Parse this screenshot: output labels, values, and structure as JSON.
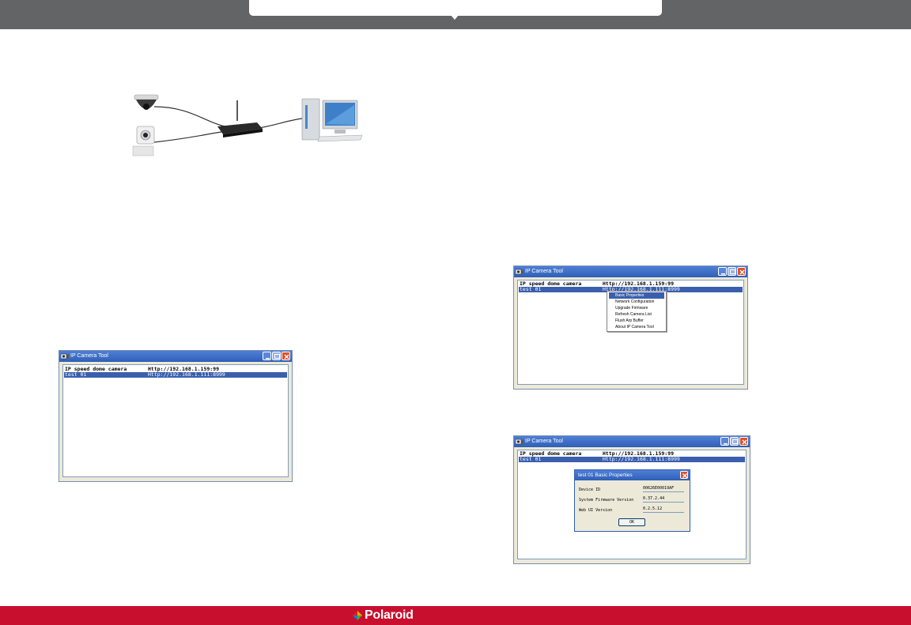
{
  "brand": {
    "name": "Polaroid"
  },
  "colors": {
    "top_bar": "#636466",
    "bottom_bar": "#c8102e",
    "selection": "#3a5fad",
    "titlebar": "#2f5fb6"
  },
  "window": {
    "title": "IP Camera Tool",
    "cameras": [
      {
        "name": "IP speed dome camera",
        "url": "Http://192.168.1.159:99"
      },
      {
        "name": "test 01",
        "url": "Http://192.168.1.111:8999"
      }
    ]
  },
  "context_menu": {
    "items": [
      "Basic Properties",
      "Network Configuration",
      "Upgrade Firmware",
      "Refresh Camera List",
      "Flush Arp Buffer",
      "About IP Camera Tool"
    ]
  },
  "dialog": {
    "title": "test 01 Basic Properties",
    "device_id_label": "Device ID",
    "device_id_value": "00626E00019AF",
    "firmware_label": "System Firmware Version",
    "firmware_value": "0.37.2.44",
    "webui_label": "Web UI Version",
    "webui_value": "0.2.5.12",
    "ok_label": "OK"
  },
  "icons": [
    "camera-app-icon",
    "minimize-icon",
    "maximize-icon",
    "close-icon",
    "polaroid-logo-icon"
  ]
}
